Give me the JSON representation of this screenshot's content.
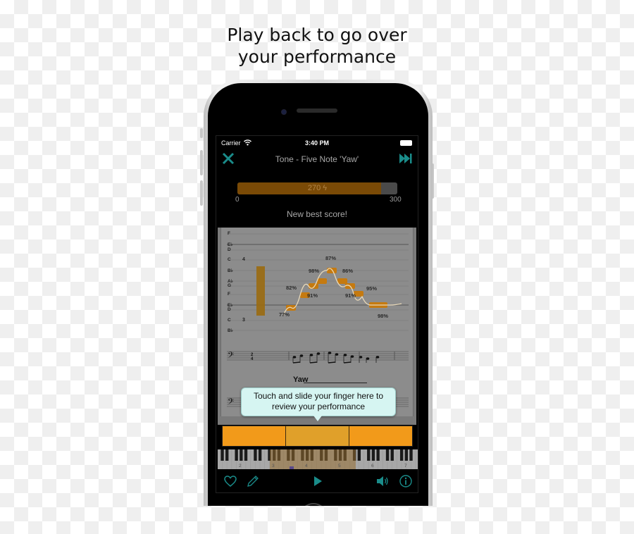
{
  "headline": {
    "line1": "Play back to go over",
    "line2": "your performance"
  },
  "status_bar": {
    "carrier": "Carrier",
    "wifi_icon": "wifi-icon",
    "time": "3:40 PM",
    "battery_icon": "battery-icon"
  },
  "nav": {
    "title": "Tone - Five Note 'Yaw'",
    "close_icon": "close-icon",
    "skip_icon": "skip-forward-icon"
  },
  "score": {
    "value": 270,
    "label": "270",
    "min": "0",
    "max": "300",
    "fraction": 0.9,
    "message": "New best score!",
    "colors": {
      "fill": "#7a4a06",
      "track": "#4a4a4a"
    }
  },
  "pitch_chart": {
    "note_labels": [
      "F",
      "E♭",
      "D",
      "C",
      "B♭",
      "A♭",
      "G",
      "F",
      "E♭",
      "D",
      "C",
      "B♭"
    ],
    "octave_labels": [
      {
        "note": "C",
        "octave": "4"
      },
      {
        "note": "C",
        "octave": "3"
      }
    ],
    "accuracies": [
      "77%",
      "82%",
      "91%",
      "98%",
      "87%",
      "86%",
      "91%",
      "95%",
      "98%"
    ],
    "accent": "#c57a10"
  },
  "notation": {
    "clef": "bass",
    "time_signature": "2/4",
    "lyric": "Yaw"
  },
  "tooltip": {
    "line1": "Touch and slide your finger here to",
    "line2": "review your performance"
  },
  "scrubber": {
    "segments": 3,
    "active_index": 1,
    "color": "#f29a1a"
  },
  "keyboard": {
    "octave_numbers": [
      "2",
      "3",
      "4",
      "5",
      "6",
      "7"
    ]
  },
  "toolbar": {
    "favorite_icon": "heart-icon",
    "edit_icon": "pencil-icon",
    "play_icon": "play-icon",
    "volume_icon": "speaker-icon",
    "info_icon": "info-icon",
    "accent": "#1a8c8a"
  }
}
